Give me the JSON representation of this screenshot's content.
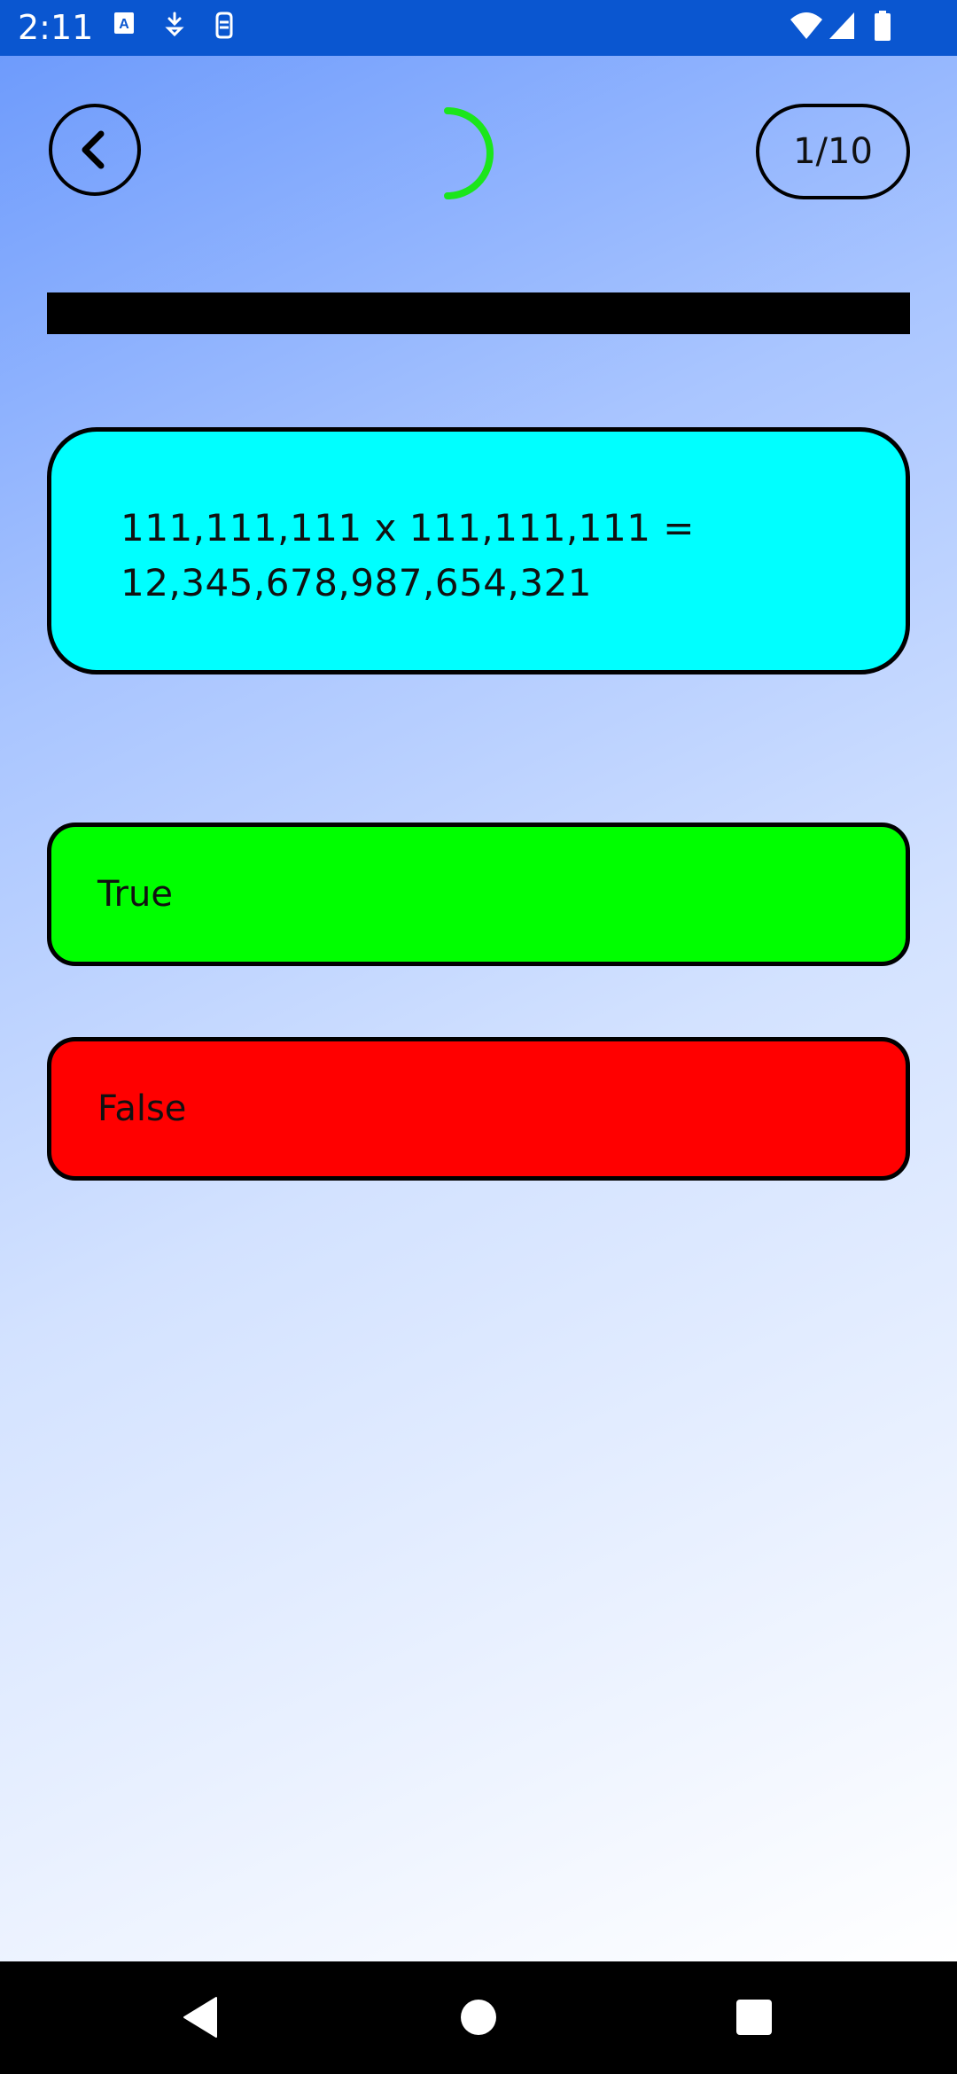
{
  "status_bar": {
    "time": "2:11",
    "icons": [
      "text-notification-icon",
      "download-icon",
      "sim-icon",
      "wifi-icon",
      "signal-icon",
      "battery-icon"
    ]
  },
  "header": {
    "back_icon": "chevron-left-icon",
    "timer_color": "#1be61b",
    "question_counter": "1/10"
  },
  "progress": {
    "fraction": 1.0,
    "color": "#000000"
  },
  "question": {
    "line1": "111,111,111 x 111,111,111 =",
    "line2": "12,345,678,987,654,321",
    "background": "#00ffff"
  },
  "answers": {
    "true_label": "True",
    "true_color": "#00ff00",
    "false_label": "False",
    "false_color": "#ff0000"
  },
  "nav_bar": {
    "icons": [
      "back-triangle-icon",
      "home-circle-icon",
      "recents-square-icon"
    ]
  }
}
